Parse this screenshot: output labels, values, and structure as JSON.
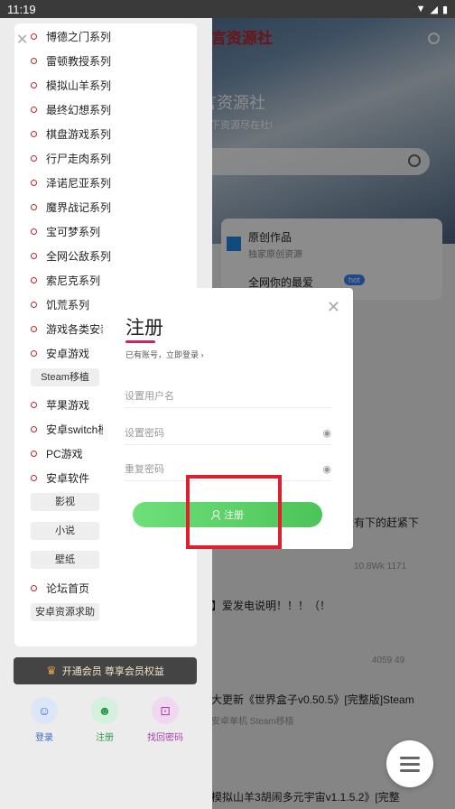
{
  "status_bar": {
    "time": "11:19"
  },
  "header": {
    "brand": "辰言资源社",
    "site_title": "言资源社",
    "site_sub": "天下资源尽在社!"
  },
  "main": {
    "card": {
      "item1": "原创作品",
      "item1_sub": "独家原创资源",
      "item2": "全网你的最爱",
      "hot_badge": "hot"
    },
    "posts": [
      {
        "title": "没有下的赶紧下",
        "meta": "10.8Wk  1171"
      },
      {
        "title": "】爱发电说明！！！（！",
        "meta": "4059  49"
      },
      {
        "title": "大更新《世界盒子v0.50.5》[完整版]Steam",
        "meta": "安卓单机  Steam移植"
      },
      {
        "title": "模拟山羊3胡闹多元宇宙v1.1.5.2》[完整",
        "meta": ""
      }
    ]
  },
  "sidebar": {
    "items": [
      {
        "label": "博德之门系列"
      },
      {
        "label": "雷顿教授系列"
      },
      {
        "label": "模拟山羊系列"
      },
      {
        "label": "最终幻想系列"
      },
      {
        "label": "棋盘游戏系列"
      },
      {
        "label": "行尸走肉系列"
      },
      {
        "label": "泽诺尼亚系列"
      },
      {
        "label": "魔界战记系列"
      },
      {
        "label": "宝可梦系列"
      },
      {
        "label": "全网公敌系列"
      },
      {
        "label": "索尼克系列"
      },
      {
        "label": "饥荒系列"
      },
      {
        "label": "游戏各类安装"
      },
      {
        "label": "安卓游戏"
      }
    ],
    "chip_steam": "Steam移植",
    "items2": [
      {
        "label": "苹果游戏"
      },
      {
        "label": "安卓switch模"
      },
      {
        "label": "PC游戏"
      },
      {
        "label": "安卓软件"
      }
    ],
    "chips2": [
      "影视",
      "小说",
      "壁纸"
    ],
    "forum_home": "论坛首页",
    "resource_request": "安卓资源求助",
    "vip_text": "开通会员 尊享会员权益",
    "bottom": {
      "login": "登录",
      "register": "注册",
      "find_password": "找回密码"
    }
  },
  "modal": {
    "title": "注册",
    "login_link": "已有账号，立即登录",
    "username_placeholder": "设置用户名",
    "password_placeholder": "设置密码",
    "repeat_placeholder": "重复密码",
    "submit": "注册"
  }
}
